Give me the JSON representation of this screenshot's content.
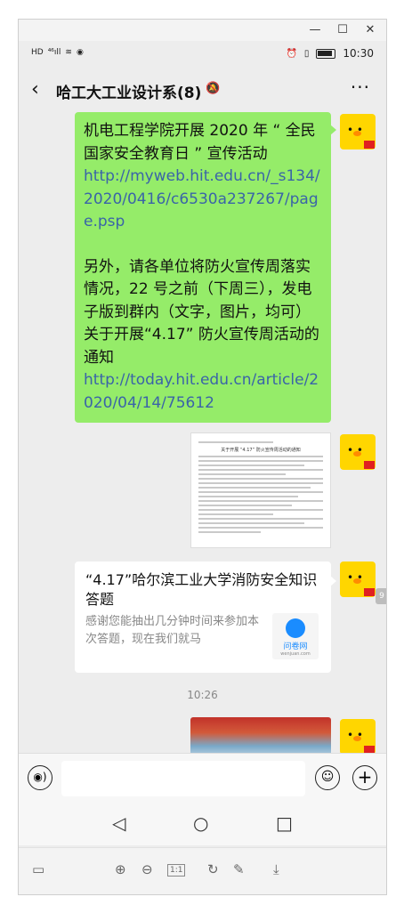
{
  "window": {
    "minimize": "—",
    "maximize": "☐",
    "close": "✕"
  },
  "status_bar": {
    "hd": "HD",
    "signal": "⁴⁶ıll",
    "wifi": "≋",
    "data": "◉",
    "alarm": "⏰",
    "vibrate": "▯",
    "time": "10:30"
  },
  "chat_header": {
    "back": "‹",
    "title": "哈工大工业设计系(8)",
    "mute": "🔕",
    "more": "···"
  },
  "messages": {
    "msg1": {
      "line1": "机电工程学院开展 2020 年 “ 全民国家安全教育日 ” 宣传活动",
      "link1": "http://myweb.hit.edu.cn/_s134/2020/0416/c6530a237267/page.psp",
      "line2": "另外，请各单位将防火宣传周落实情况，22 号之前（下周三），发电子版到群内（文字，图片，均可）关于开展“4.17” 防火宣传周活动的通知",
      "link2": "http://today.hit.edu.cn/article/2020/04/14/75612"
    },
    "msg2_doc_title": "关于开展 “4.17” 防火宣传周活动的通知",
    "msg3": {
      "title": "“4.17”哈尔滨工业大学消防安全知识答题",
      "desc": "感谢您能抽出几分钟时间来参加本次答题，现在我们就马",
      "logo_brand": "问卷网",
      "logo_url": "wenjuan.com"
    },
    "timestamp": "10:26",
    "side_chip": "9"
  },
  "input_bar": {
    "voice": "◉)",
    "emoji": "☺",
    "plus": "+"
  },
  "nav": {
    "back": "◁",
    "home": "○",
    "recents": "□"
  },
  "toolbar": {
    "screen": "▭",
    "zoom_in": "⊕",
    "zoom_out": "⊖",
    "actual": "1:1",
    "rotate": "↻",
    "edit": "✎",
    "download": "⤓"
  }
}
